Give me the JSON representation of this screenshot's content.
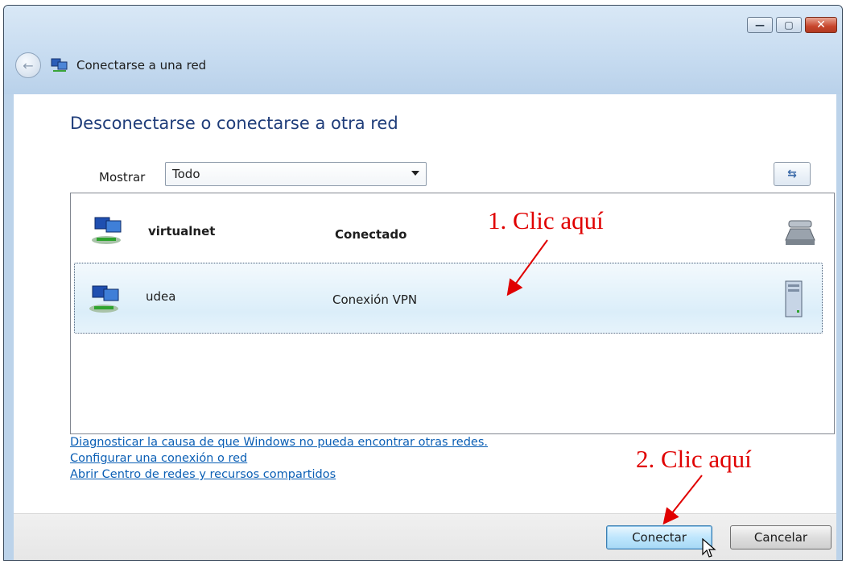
{
  "window": {
    "title": "Conectarse a una red",
    "controls": {
      "minimize": "minimize-icon",
      "maximize": "maximize-icon",
      "close": "close-icon"
    }
  },
  "main": {
    "heading": "Desconectarse o conectarse a otra red",
    "filter": {
      "label": "Mostrar",
      "selected": "Todo"
    },
    "networks": [
      {
        "name": "virtualnet",
        "status": "Conectado",
        "icon": "network-icon",
        "type_icon": "dialup-phone-icon"
      },
      {
        "name": "udea",
        "status": "Conexión VPN",
        "icon": "network-icon",
        "type_icon": "server-icon",
        "selected": true
      }
    ],
    "links": [
      "Diagnosticar la causa de que Windows no pueda encontrar otras redes.",
      "Configurar una conexión o red",
      "Abrir Centro de redes y recursos compartidos"
    ]
  },
  "footer": {
    "connect_label": "Conectar",
    "cancel_label": "Cancelar"
  },
  "annotations": {
    "step1": "1. Clic aquí",
    "step2": "2. Clic aquí",
    "color": "#e00000"
  }
}
